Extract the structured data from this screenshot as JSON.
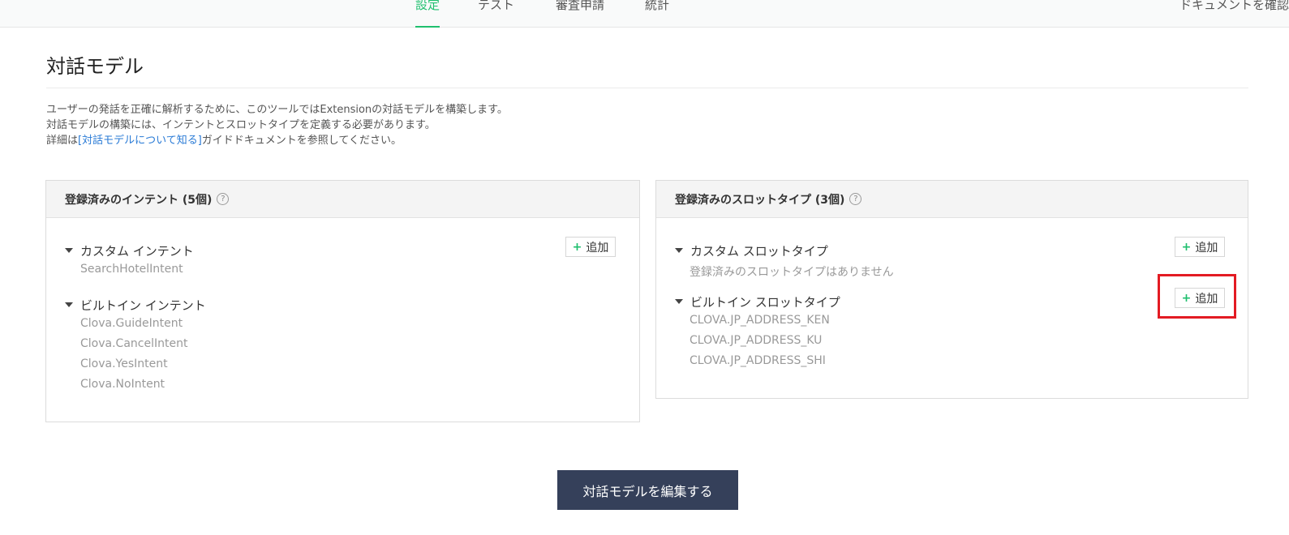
{
  "nav": {
    "tabs": [
      {
        "label": "設定",
        "active": true
      },
      {
        "label": "テスト",
        "active": false
      },
      {
        "label": "審査申請",
        "active": false
      },
      {
        "label": "統計",
        "active": false
      }
    ],
    "doc_link": "ドキュメントを確認"
  },
  "page": {
    "title": "対話モデル",
    "description": {
      "line1": "ユーザーの発話を正確に解析するために、このツールではExtensionの対話モデルを構築します。",
      "line2": "対話モデルの構築には、インテントとスロットタイプを定義する必要があります。",
      "line3_prefix": "詳細は",
      "line3_link": "[対話モデルについて知る]",
      "line3_suffix": "ガイドドキュメントを参照してください。"
    }
  },
  "intents_panel": {
    "title": "登録済みのインテント (5個)",
    "help_icon": "question-circle-icon",
    "custom": {
      "label": "カスタム インテント",
      "items": [
        "SearchHotelIntent"
      ]
    },
    "builtin": {
      "label": "ビルトイン インテント",
      "items": [
        "Clova.GuideIntent",
        "Clova.CancelIntent",
        "Clova.YesIntent",
        "Clova.NoIntent"
      ]
    },
    "add_label": "追加"
  },
  "slots_panel": {
    "title": "登録済みのスロットタイプ (3個)",
    "help_icon": "question-circle-icon",
    "custom": {
      "label": "カスタム スロットタイプ",
      "empty_text": "登録済みのスロットタイプはありません",
      "add_label": "追加"
    },
    "builtin": {
      "label": "ビルトイン スロットタイプ",
      "items": [
        "CLOVA.JP_ADDRESS_KEN",
        "CLOVA.JP_ADDRESS_KU",
        "CLOVA.JP_ADDRESS_SHI"
      ],
      "add_label": "追加"
    }
  },
  "edit_button": "対話モデルを編集する",
  "colors": {
    "accent_green": "#1fbf6e",
    "link_blue": "#2a7bd6",
    "highlight_red": "#e31b23",
    "button_navy": "#35405a"
  }
}
